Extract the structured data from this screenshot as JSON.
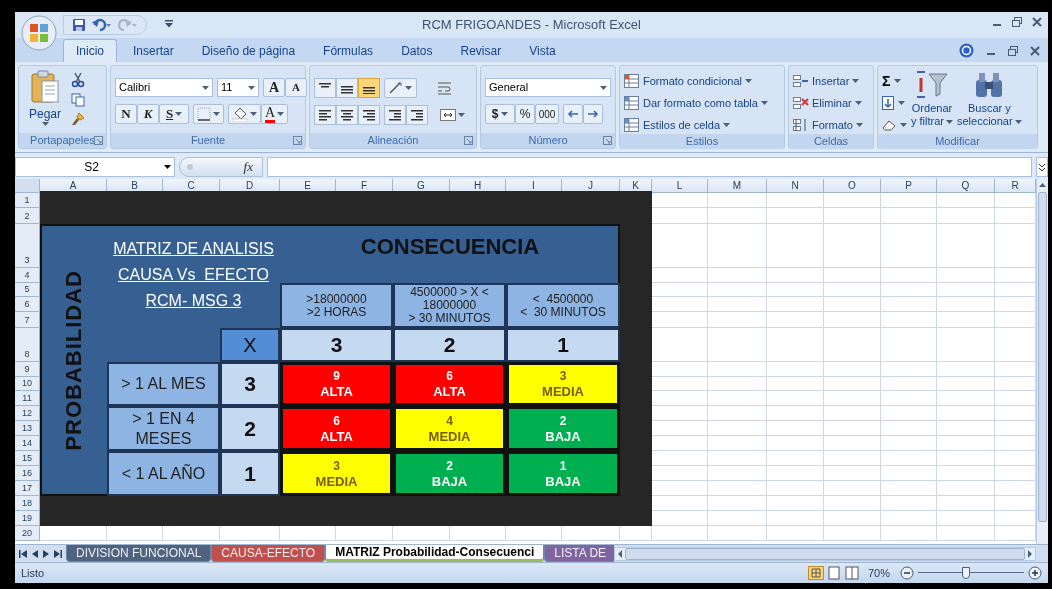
{
  "window": {
    "title": "RCM FRIGOANDES - Microsoft Excel"
  },
  "ribbon_tabs": [
    {
      "label": "Inicio",
      "selected": true
    },
    {
      "label": "Insertar",
      "selected": false
    },
    {
      "label": "Diseño de página",
      "selected": false
    },
    {
      "label": "Fórmulas",
      "selected": false
    },
    {
      "label": "Datos",
      "selected": false
    },
    {
      "label": "Revisar",
      "selected": false
    },
    {
      "label": "Vista",
      "selected": false
    }
  ],
  "ribbon": {
    "clipboard": {
      "label": "Portapapeles",
      "paste": "Pegar"
    },
    "font": {
      "label": "Fuente",
      "font_name": "Calibri",
      "font_size": "11",
      "grow": "A",
      "shrink": "A",
      "bold": "N",
      "italic": "K",
      "underline": "S",
      "font_color": "A"
    },
    "alignment": {
      "label": "Alineación"
    },
    "number": {
      "label": "Número",
      "format": "General",
      "currency": "$",
      "percent": "%",
      "thousands": "000"
    },
    "styles": {
      "label": "Estilos",
      "items": [
        "Formato condicional",
        "Dar formato como tabla",
        "Estilos de celda"
      ]
    },
    "cells": {
      "label": "Celdas",
      "items": [
        "Insertar",
        "Eliminar",
        "Formato"
      ]
    },
    "editing": {
      "label": "Modificar",
      "sum": "Σ",
      "sort": [
        "Ordenar",
        "y filtrar"
      ],
      "find": [
        "Buscar y",
        "seleccionar"
      ]
    }
  },
  "formula_bar": {
    "name_box": "S2",
    "fx": "fx"
  },
  "columns": [
    "A",
    "B",
    "C",
    "D",
    "E",
    "F",
    "G",
    "H",
    "I",
    "J",
    "K",
    "L",
    "M",
    "N",
    "O",
    "P",
    "Q",
    "R"
  ],
  "rows": [
    "1",
    "2",
    "3",
    "4",
    "5",
    "6",
    "7",
    "8",
    "9",
    "10",
    "11",
    "12",
    "13",
    "14",
    "15",
    "16",
    "17",
    "18",
    "19",
    "20"
  ],
  "matrix": {
    "title_lines": [
      "MATRIZ DE ANALISIS",
      "CAUSA Vs  EFECTO",
      "RCM- MSG 3"
    ],
    "axis_label": "PROBABILIDAD",
    "consequence_title": "CONSECUENCIA",
    "corner": "X",
    "consequence_levels": [
      {
        "criteria": [
          ">18000000",
          ">2 HORAS"
        ],
        "score": "3"
      },
      {
        "criteria": [
          "4500000 > X <",
          "18000000",
          "> 30 MINUTOS"
        ],
        "score": "2"
      },
      {
        "criteria": [
          "<  4500000",
          "<  30 MINUTOS"
        ],
        "score": "1"
      }
    ],
    "probability_levels": [
      {
        "label": "> 1 AL MES",
        "score": "3",
        "cells": [
          {
            "value": "9",
            "rating": "ALTA",
            "color": "#ff0000"
          },
          {
            "value": "6",
            "rating": "ALTA",
            "color": "#ff0000"
          },
          {
            "value": "3",
            "rating": "MEDIA",
            "color": "#ffff00"
          }
        ]
      },
      {
        "label": "> 1 EN 4 MESES",
        "score": "2",
        "cells": [
          {
            "value": "6",
            "rating": "ALTA",
            "color": "#ff0000"
          },
          {
            "value": "4",
            "rating": "MEDIA",
            "color": "#ffff00"
          },
          {
            "value": "2",
            "rating": "BAJA",
            "color": "#00b050"
          }
        ]
      },
      {
        "label": "< 1 AL AÑO",
        "score": "1",
        "cells": [
          {
            "value": "3",
            "rating": "MEDIA",
            "color": "#ffff00"
          },
          {
            "value": "2",
            "rating": "BAJA",
            "color": "#00b050"
          },
          {
            "value": "1",
            "rating": "BAJA",
            "color": "#00b050"
          }
        ]
      }
    ]
  },
  "sheet_tabs": [
    {
      "label": "DIVISION FUNCIONAL",
      "selected": false,
      "color": "#4f6280"
    },
    {
      "label": "CAUSA-EFECTO",
      "selected": false,
      "color": "#c0504d"
    },
    {
      "label": "MATRIZ Probabilidad-Consecuenci",
      "selected": true,
      "color": "#9bbb59"
    },
    {
      "label": "LISTA DE",
      "selected": false,
      "color": "#8064a2"
    }
  ],
  "status_bar": {
    "status": "Listo",
    "zoom": "70%",
    "zoom_slider": {
      "level": 0.45
    }
  }
}
